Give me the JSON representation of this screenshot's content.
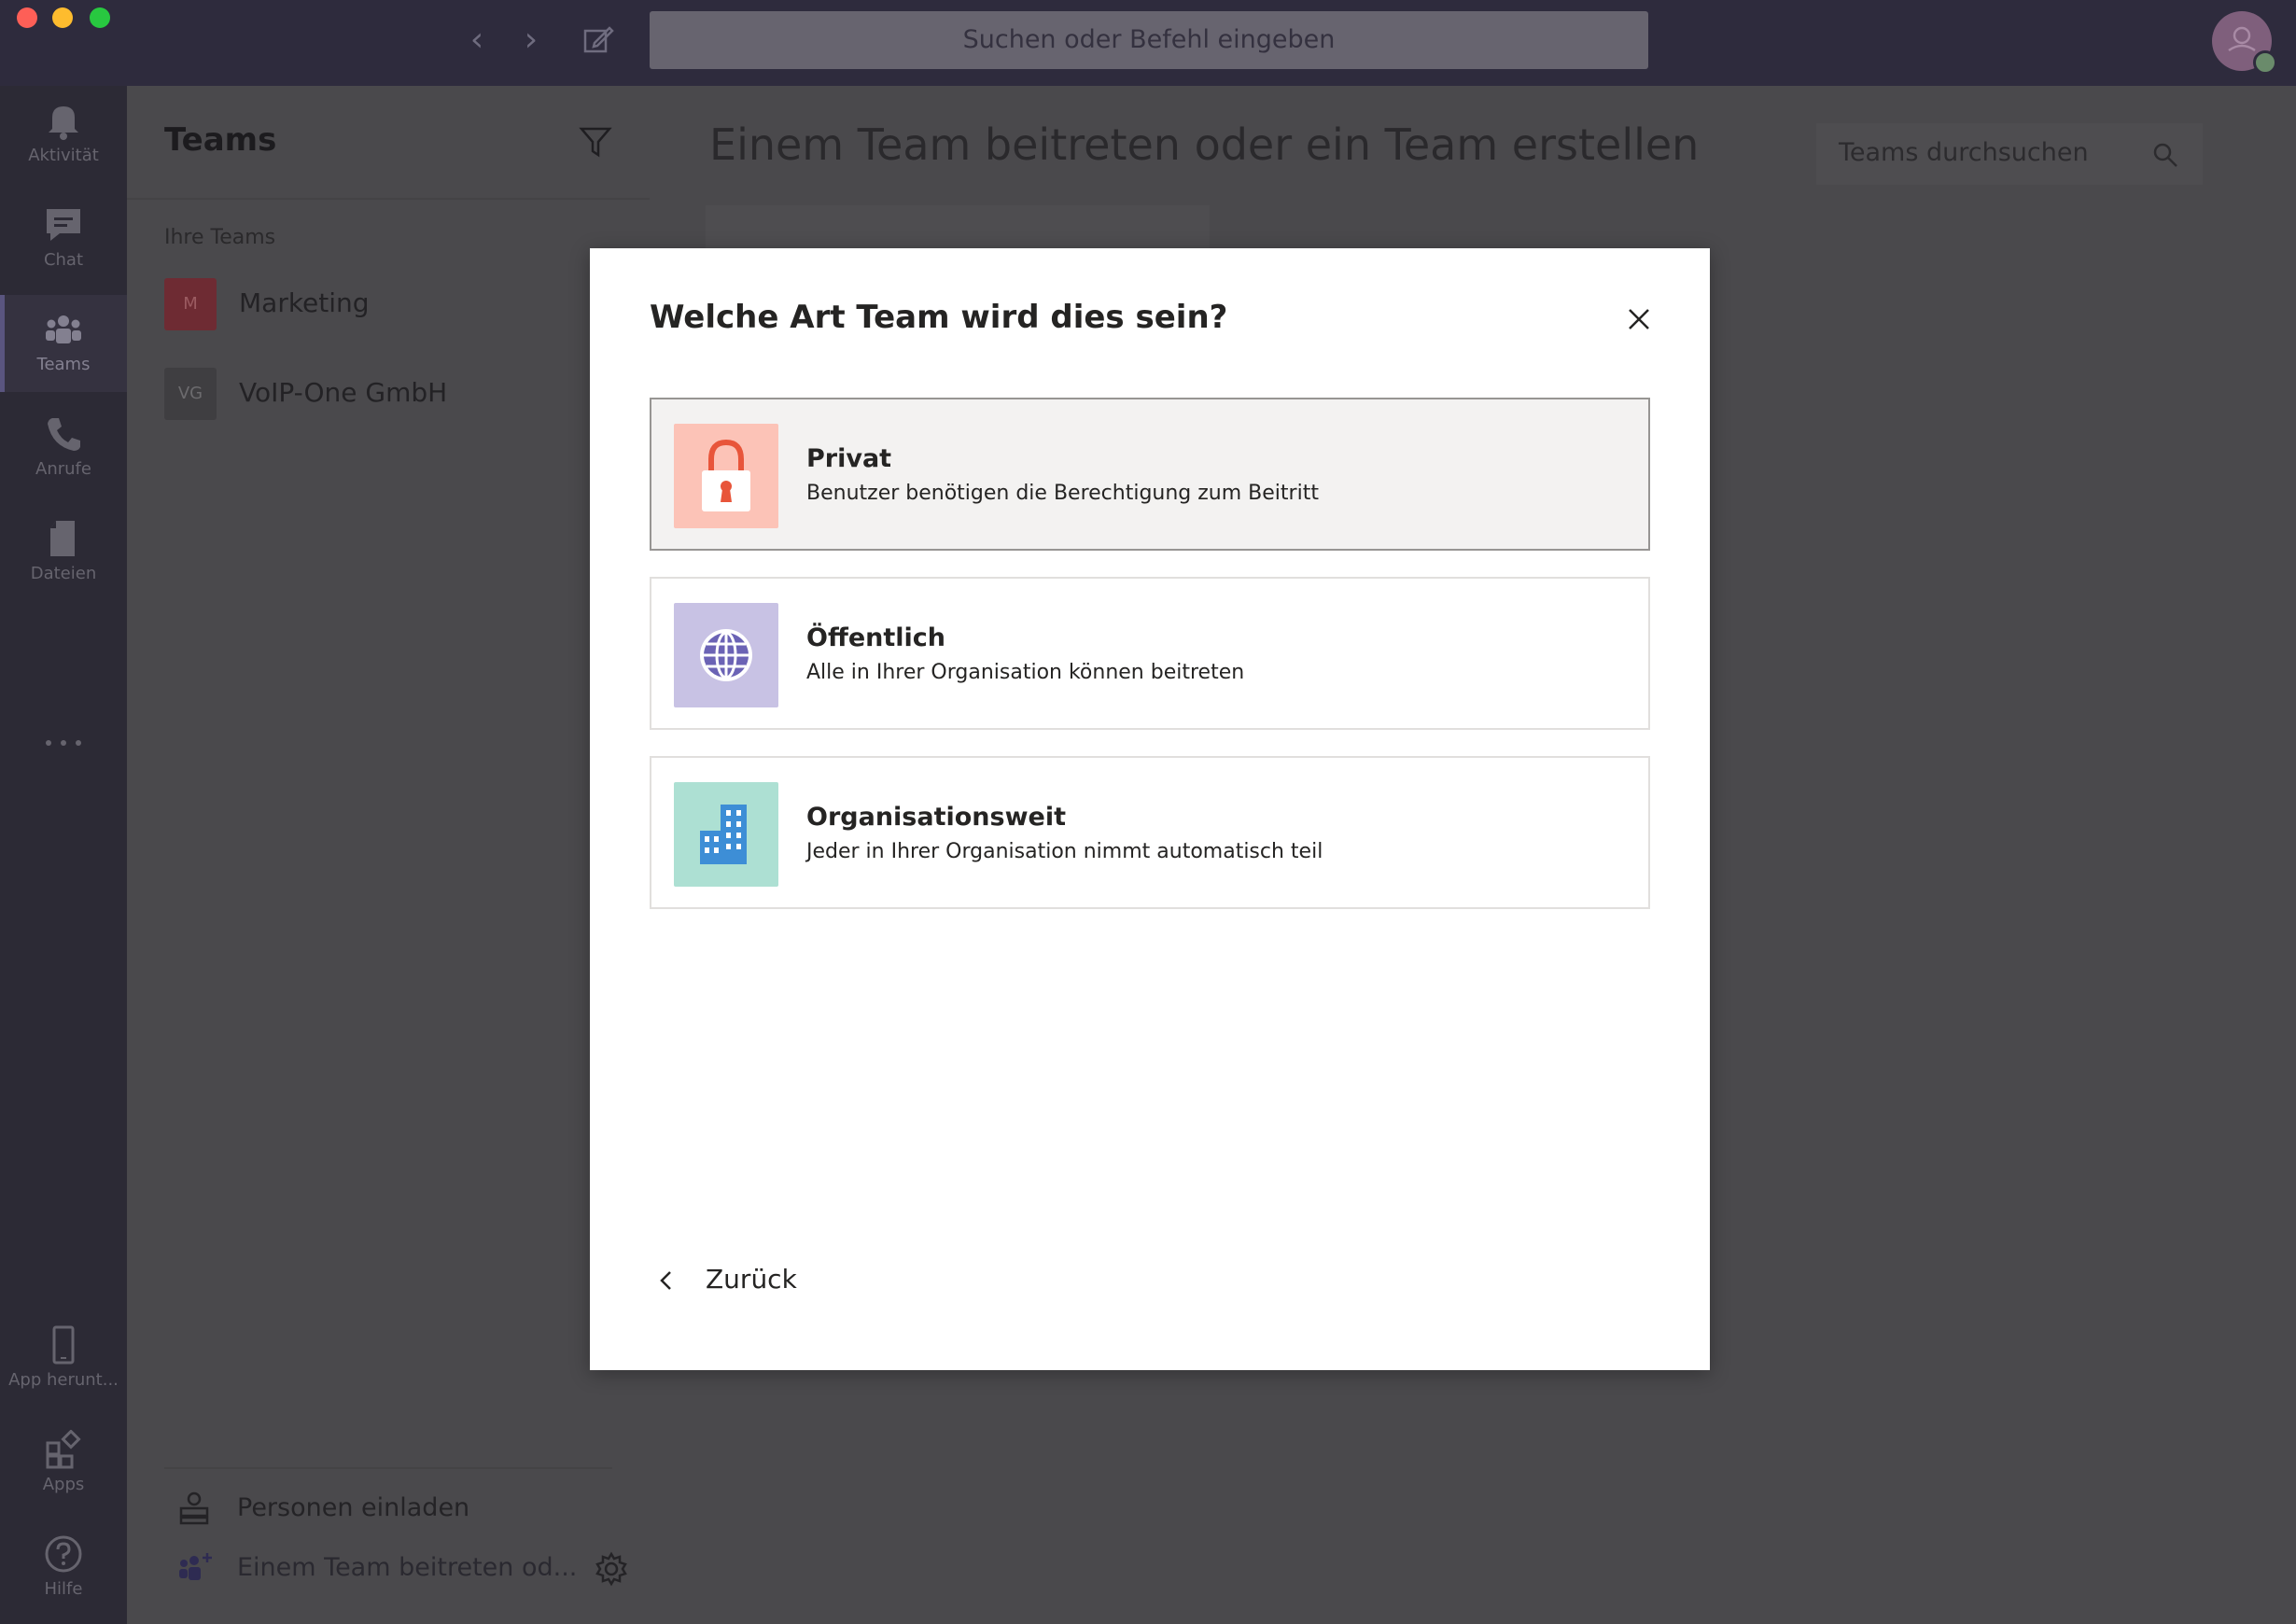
{
  "window": {
    "search_placeholder": "Suchen oder Befehl eingeben"
  },
  "rail": {
    "items": [
      {
        "label": "Aktivität",
        "icon": "bell-icon"
      },
      {
        "label": "Chat",
        "icon": "chat-icon"
      },
      {
        "label": "Teams",
        "icon": "teams-icon"
      },
      {
        "label": "Anrufe",
        "icon": "phone-icon"
      },
      {
        "label": "Dateien",
        "icon": "file-icon"
      }
    ],
    "bottom_items": [
      {
        "label": "App herunt...",
        "icon": "mobile-icon"
      },
      {
        "label": "Apps",
        "icon": "apps-icon"
      },
      {
        "label": "Hilfe",
        "icon": "help-icon"
      }
    ]
  },
  "panel": {
    "title": "Teams",
    "section_label": "Ihre Teams",
    "teams": [
      {
        "initials": "M",
        "name": "Marketing",
        "color": "#6e2b33"
      },
      {
        "initials": "VG",
        "name": "VoIP-One GmbH",
        "color": "#3f3e41"
      }
    ],
    "invite_label": "Personen einladen",
    "join_label": "Einem Team beitreten od..."
  },
  "main": {
    "title": "Einem Team beitreten oder ein Team erstellen",
    "search_placeholder": "Teams durchsuchen"
  },
  "modal": {
    "title": "Welche Art Team wird dies sein?",
    "options": [
      {
        "title": "Privat",
        "description": "Benutzer benötigen die Berechtigung zum Beitritt",
        "icon": "lock-icon",
        "tile_color": "#fcc3b7",
        "selected": true
      },
      {
        "title": "Öffentlich",
        "description": "Alle in Ihrer Organisation können beitreten",
        "icon": "globe-icon",
        "tile_color": "#c8c2e4",
        "selected": false
      },
      {
        "title": "Organisationsweit",
        "description": "Jeder in Ihrer Organisation nimmt automatisch teil",
        "icon": "building-icon",
        "tile_color": "#ade0d3",
        "selected": false
      }
    ],
    "back_label": "Zurück"
  }
}
